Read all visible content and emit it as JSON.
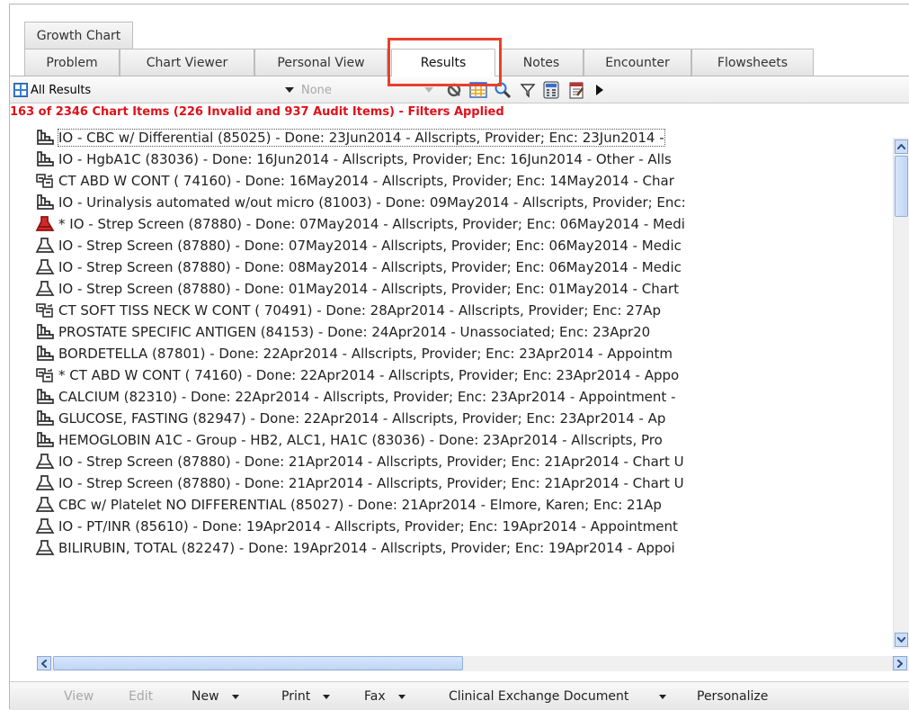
{
  "tabs_row1": [
    {
      "label": "Growth Chart"
    }
  ],
  "tabs_row2": [
    {
      "label": "Problem"
    },
    {
      "label": "Chart Viewer"
    },
    {
      "label": "Personal View"
    },
    {
      "label": "Results"
    },
    {
      "label": "Notes"
    },
    {
      "label": "Encounter"
    },
    {
      "label": "Flowsheets"
    }
  ],
  "active_tab": "Results",
  "toolbar": {
    "view_select": "All Results",
    "filter_select": "None"
  },
  "status": "163 of 2346 Chart Items (226 Invalid and 937 Audit Items) - Filters Applied",
  "items": [
    {
      "icon": "lab",
      "text": "IO - CBC w/ Differential  (85025) - Done: 23Jun2014 - Allscripts, Provider; Enc: 23Jun2014 -"
    },
    {
      "icon": "lab",
      "text": "IO - HgbA1C (83036) - Done: 16Jun2014 - Allscripts, Provider; Enc: 16Jun2014 - Other - Alls"
    },
    {
      "icon": "imaging",
      "text": "CT ABD W CONT ( 74160) - Done: 16May2014 - Allscripts, Provider; Enc: 14May2014 - Char"
    },
    {
      "icon": "lab",
      "text": "IO - Urinalysis automated w/out micro (81003) - Done: 09May2014 - Allscripts, Provider; Enc:"
    },
    {
      "icon": "flask-red",
      "text": "* IO - Strep Screen (87880) - Done: 07May2014 - Allscripts, Provider; Enc: 06May2014 - Medi"
    },
    {
      "icon": "flask",
      "text": "IO - Strep Screen (87880) - Done: 07May2014 - Allscripts, Provider; Enc: 06May2014 - Medic"
    },
    {
      "icon": "flask",
      "text": "IO - Strep Screen (87880) - Done: 08May2014 - Allscripts, Provider; Enc: 06May2014 - Medic"
    },
    {
      "icon": "flask",
      "text": "IO - Strep Screen (87880) - Done: 01May2014 - Allscripts, Provider; Enc: 01May2014 - Chart"
    },
    {
      "icon": "imaging",
      "text": "CT SOFT TISS NECK W CONT ( 70491) - Done: 28Apr2014 - Allscripts, Provider; Enc: 27Ap"
    },
    {
      "icon": "lab",
      "text": "PROSTATE SPECIFIC ANTIGEN (84153) - Done: 24Apr2014 - Unassociated; Enc: 23Apr20"
    },
    {
      "icon": "lab",
      "text": "BORDETELLA (87801) - Done: 22Apr2014 - Allscripts, Provider; Enc: 23Apr2014 - Appointm"
    },
    {
      "icon": "imaging",
      "text": "* CT ABD W CONT ( 74160) - Done: 22Apr2014 - Allscripts, Provider; Enc: 23Apr2014 - Appo"
    },
    {
      "icon": "lab",
      "text": "CALCIUM (82310) - Done: 22Apr2014 - Allscripts, Provider; Enc: 23Apr2014 - Appointment -"
    },
    {
      "icon": "lab",
      "text": "GLUCOSE, FASTING (82947) - Done: 22Apr2014 - Allscripts, Provider; Enc: 23Apr2014 - Ap"
    },
    {
      "icon": "lab",
      "text": "HEMOGLOBIN A1C - Group - HB2, ALC1, HA1C (83036) - Done: 23Apr2014 - Allscripts, Pro"
    },
    {
      "icon": "flask",
      "text": "IO - Strep Screen (87880) - Done: 21Apr2014 - Allscripts, Provider; Enc: 21Apr2014 - Chart U"
    },
    {
      "icon": "flask",
      "text": "IO - Strep Screen (87880) - Done: 21Apr2014 - Allscripts, Provider; Enc: 21Apr2014 - Chart U"
    },
    {
      "icon": "flask",
      "text": "CBC w/ Platelet  NO DIFFERENTIAL (85027) - Done: 21Apr2014 - Elmore, Karen; Enc: 21Ap"
    },
    {
      "icon": "flask",
      "text": "IO - PT/INR (85610) - Done: 19Apr2014 - Allscripts, Provider; Enc: 19Apr2014 - Appointment"
    },
    {
      "icon": "flask",
      "text": "BILIRUBIN, TOTAL (82247) - Done: 19Apr2014 - Allscripts, Provider; Enc: 19Apr2014 - Appoi"
    }
  ],
  "bottom_bar": {
    "view": "View",
    "edit": "Edit",
    "new": "New",
    "print": "Print",
    "fax": "Fax",
    "clinical": "Clinical Exchange Document",
    "personalize": "Personalize"
  },
  "colors": {
    "highlight": "#e8402b",
    "status": "#e0101a",
    "scroll_thumb": "#c9dbf7"
  }
}
